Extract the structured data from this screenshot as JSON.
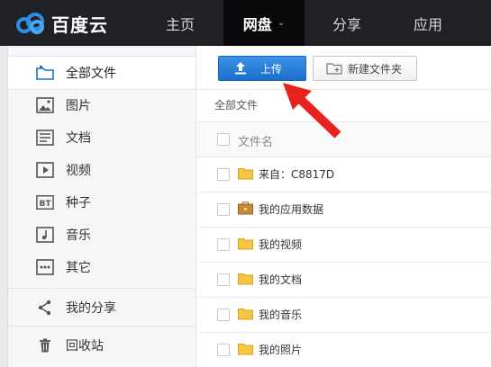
{
  "header": {
    "logo_text": "百度云",
    "nav": [
      {
        "label": "主页",
        "active": false
      },
      {
        "label": "网盘",
        "active": true
      },
      {
        "label": "分享",
        "active": false
      },
      {
        "label": "应用",
        "active": false
      }
    ],
    "caret": "⌄"
  },
  "sidebar": {
    "items": [
      {
        "label": "全部文件",
        "icon": "folder-icon",
        "active": true
      },
      {
        "label": "图片",
        "icon": "image-icon"
      },
      {
        "label": "文档",
        "icon": "document-icon"
      },
      {
        "label": "视频",
        "icon": "video-icon"
      },
      {
        "label": "种子",
        "icon": "bt-icon",
        "icon_text": "BT"
      },
      {
        "label": "音乐",
        "icon": "music-icon"
      },
      {
        "label": "其它",
        "icon": "more-icon"
      },
      {
        "label": "我的分享",
        "icon": "share-icon"
      },
      {
        "label": "回收站",
        "icon": "trash-icon"
      }
    ]
  },
  "toolbar": {
    "upload_label": "上传",
    "new_folder_label": "新建文件夹"
  },
  "breadcrumb": "全部文件",
  "file_list": {
    "column_header": "文件名",
    "files": [
      {
        "name": "来自：C8817D",
        "icon": "folder-icon"
      },
      {
        "name": "我的应用数据",
        "icon": "app-folder-icon"
      },
      {
        "name": "我的视频",
        "icon": "folder-icon"
      },
      {
        "name": "我的文档",
        "icon": "folder-icon"
      },
      {
        "name": "我的音乐",
        "icon": "folder-icon"
      },
      {
        "name": "我的照片",
        "icon": "folder-icon"
      }
    ]
  },
  "colors": {
    "topbar": "#1f2126",
    "accent": "#1c6fcc",
    "arrow": "#e8231d",
    "folder": "#f6c544"
  }
}
